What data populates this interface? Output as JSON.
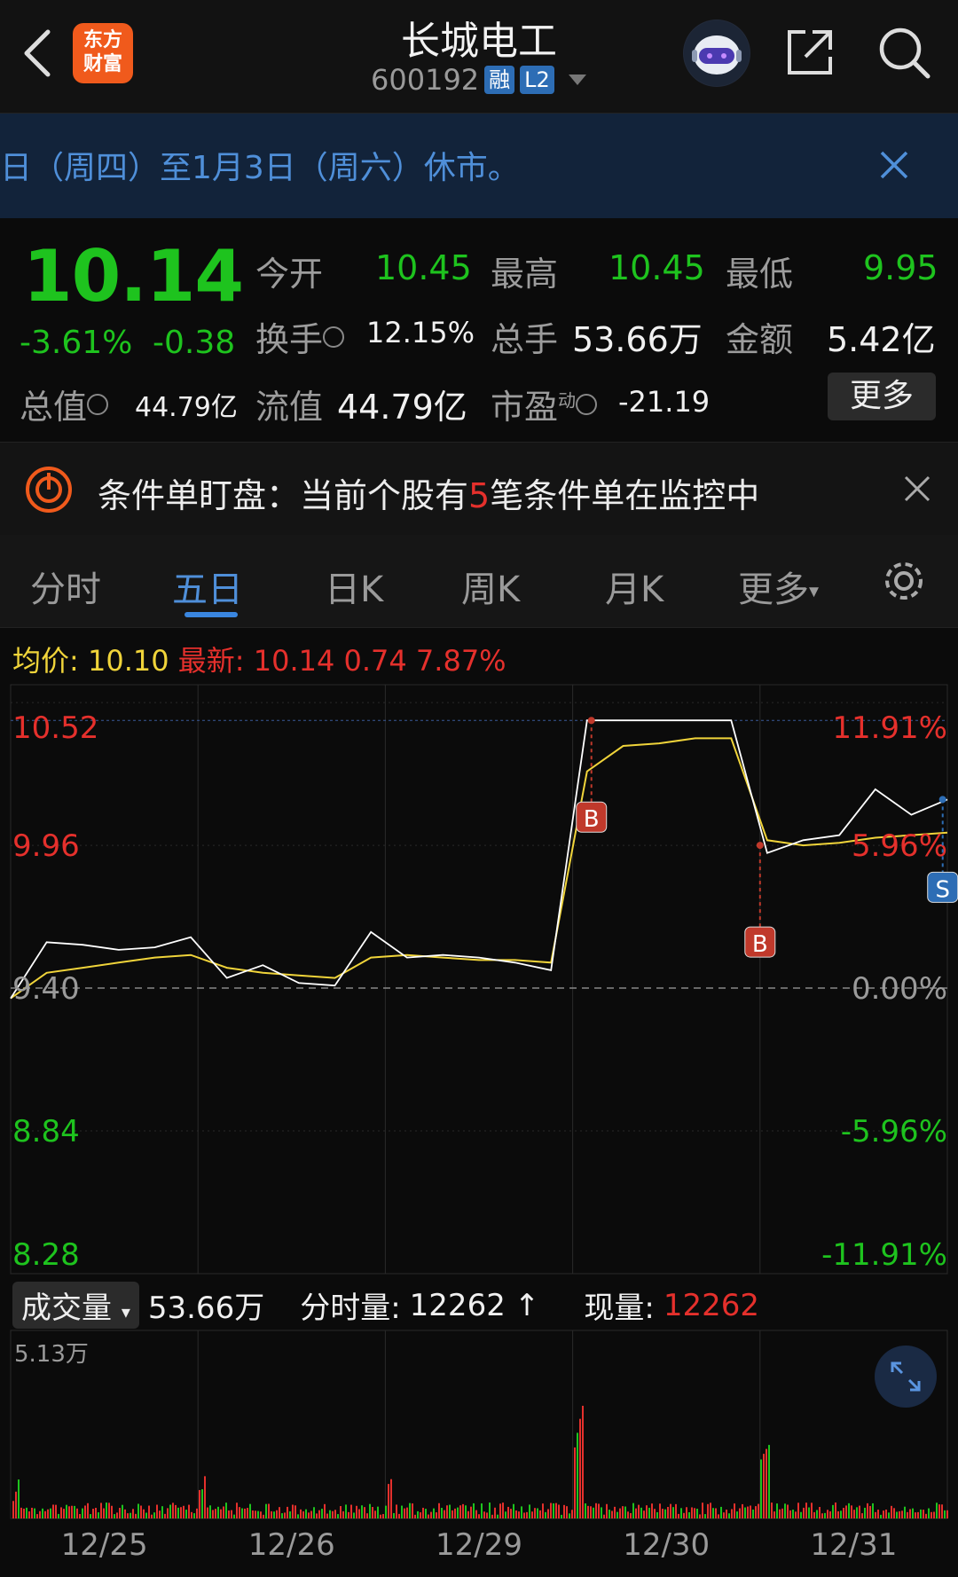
{
  "header": {
    "logo_line1": "东方",
    "logo_line2": "财富",
    "stock_name": "长城电工",
    "stock_code": "600192",
    "tag_rong": "融",
    "tag_l2": "L2"
  },
  "notice": {
    "text": "日（周四）至1月3日（周六）休市。"
  },
  "quote": {
    "price": "10.14",
    "change_pct": "-3.61%",
    "change_abs": "-0.38",
    "open_label": "今开",
    "open_value": "10.45",
    "high_label": "最高",
    "high_value": "10.45",
    "low_label": "最低",
    "low_value": "9.95",
    "turnover_label": "换手",
    "turnover_value": "12.15%",
    "volume_label": "总手",
    "volume_value": "53.66万",
    "amount_label": "金额",
    "amount_value": "5.42亿",
    "mktcap_label": "总值",
    "mktcap_value": "44.79亿",
    "float_label": "流值",
    "float_value": "44.79亿",
    "pe_label": "市盈",
    "pe_sup": "动",
    "pe_value": "-21.19",
    "more": "更多"
  },
  "alert": {
    "prefix": "条件单盯盘：当前个股有",
    "count": "5",
    "suffix": "笔条件单在监控中"
  },
  "tabs": [
    "分时",
    "五日",
    "日K",
    "周K",
    "月K",
    "更多"
  ],
  "info": {
    "avg_label": "均价:",
    "avg_value": "10.10",
    "latest_label": "最新:",
    "latest_price": "10.14",
    "latest_chg": "0.74",
    "latest_pct": "7.87%"
  },
  "chart_data": {
    "type": "line",
    "x": [
      "12/25",
      "12/26",
      "12/29",
      "12/30",
      "12/31"
    ],
    "y_left_ticks": [
      "10.52",
      "9.96",
      "9.40",
      "8.84",
      "8.28"
    ],
    "y_right_ticks": [
      "11.91%",
      "5.96%",
      "0.00%",
      "-5.96%",
      "-11.91%"
    ],
    "ylim": [
      8.28,
      10.52
    ],
    "reference_price": 9.4,
    "series": [
      {
        "name": "均价",
        "color": "#f0d43a",
        "values": [
          9.36,
          9.46,
          9.48,
          9.5,
          9.52,
          9.53,
          9.48,
          9.46,
          9.45,
          9.44,
          9.52,
          9.53,
          9.52,
          9.51,
          9.51,
          9.5,
          10.25,
          10.35,
          10.36,
          10.38,
          10.38,
          9.98,
          9.96,
          9.97,
          9.99,
          10.0,
          10.01
        ]
      },
      {
        "name": "价格",
        "color": "#ffffff",
        "values": [
          9.36,
          9.58,
          9.57,
          9.55,
          9.56,
          9.6,
          9.44,
          9.49,
          9.42,
          9.41,
          9.62,
          9.52,
          9.53,
          9.52,
          9.5,
          9.47,
          10.45,
          10.45,
          10.45,
          10.45,
          10.45,
          9.93,
          9.98,
          10.0,
          10.18,
          10.08,
          10.14
        ]
      }
    ],
    "markers": [
      {
        "label": "B",
        "value": 10.45
      },
      {
        "label": "B",
        "value": 9.96
      },
      {
        "label": "S",
        "value": 10.14
      }
    ]
  },
  "volume": {
    "selector": "成交量",
    "total": "53.66万",
    "fenshi_label": "分时量:",
    "fenshi_value": "12262",
    "xian_label": "现量:",
    "xian_value": "12262",
    "max_label": "5.13万"
  }
}
